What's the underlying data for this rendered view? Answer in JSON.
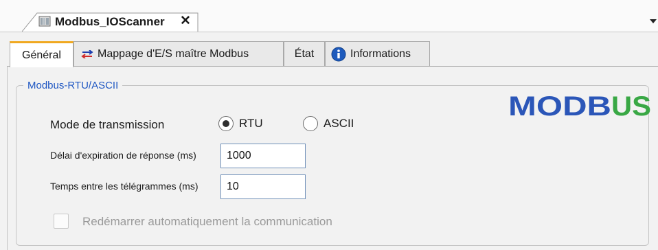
{
  "document_tab": {
    "title": "Modbus_IOScanner",
    "close_symbol": "✕",
    "icon": "device-icon"
  },
  "tabs": [
    {
      "label": "Général",
      "active": true,
      "icon": null
    },
    {
      "label": "Mappage d'E/S maître Modbus",
      "active": false,
      "icon": "mapping-arrows-icon"
    },
    {
      "label": "État",
      "active": false,
      "icon": null
    },
    {
      "label": "Informations",
      "active": false,
      "icon": "info-icon"
    }
  ],
  "group": {
    "title": "Modbus-RTU/ASCII",
    "logo_text": "MODBUS"
  },
  "transmission": {
    "label": "Mode de transmission",
    "options": [
      "RTU",
      "ASCII"
    ],
    "selected": "RTU"
  },
  "timeout": {
    "label": "Délai d'expiration de réponse (ms)",
    "value": "1000"
  },
  "interframe": {
    "label": "Temps entre les télégrammes (ms)",
    "value": "10"
  },
  "auto_restart": {
    "label": "Redémarrer automatiquement la communication",
    "checked": false,
    "enabled": false
  },
  "colors": {
    "accent_tab": "#f0a820",
    "group_title": "#1f57c3",
    "logo_blue": "#2b56b8",
    "logo_green": "#39a845"
  }
}
